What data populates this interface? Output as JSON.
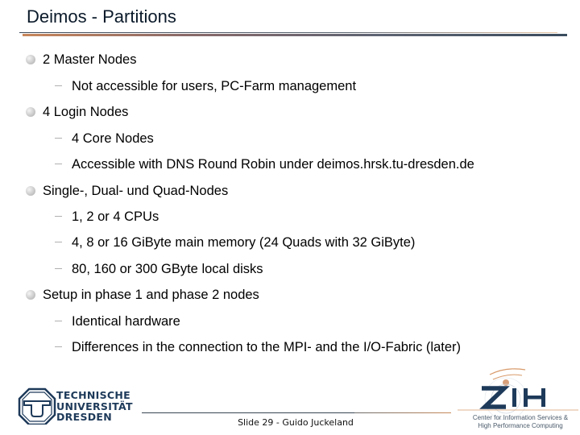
{
  "slide": {
    "title": "Deimos - Partitions",
    "bullets": [
      {
        "text": "2 Master Nodes",
        "children": [
          "Not accessible for users, PC-Farm management"
        ]
      },
      {
        "text": "4 Login Nodes",
        "children": [
          "4 Core Nodes",
          "Accessible with DNS Round Robin under deimos.hrsk.tu-dresden.de"
        ]
      },
      {
        "text": "Single-, Dual- und Quad-Nodes",
        "children": [
          "1, 2 or 4 CPUs",
          "4, 8 or 16 GiByte main memory (24 Quads with 32 GiByte)",
          "80, 160 or 300 GByte local disks"
        ]
      },
      {
        "text": "Setup in phase 1 and phase 2 nodes",
        "children": [
          "Identical hardware",
          "Differences in the connection to the MPI- and the I/O-Fabric (later)"
        ]
      }
    ]
  },
  "footer": {
    "text": "Slide 29 - Guido Juckeland",
    "tud_logo": {
      "line1": "TECHNISCHE",
      "line2": "UNIVERSITÄT",
      "line3": "DRESDEN"
    },
    "zih_logo": {
      "name": "ZIH",
      "line1": "Center for Information Services &",
      "line2": "High Performance Computing"
    }
  },
  "colors": {
    "title": "#0b1a2a",
    "accent_orange": "#c8865a",
    "accent_blue": "#1e3a5a"
  }
}
